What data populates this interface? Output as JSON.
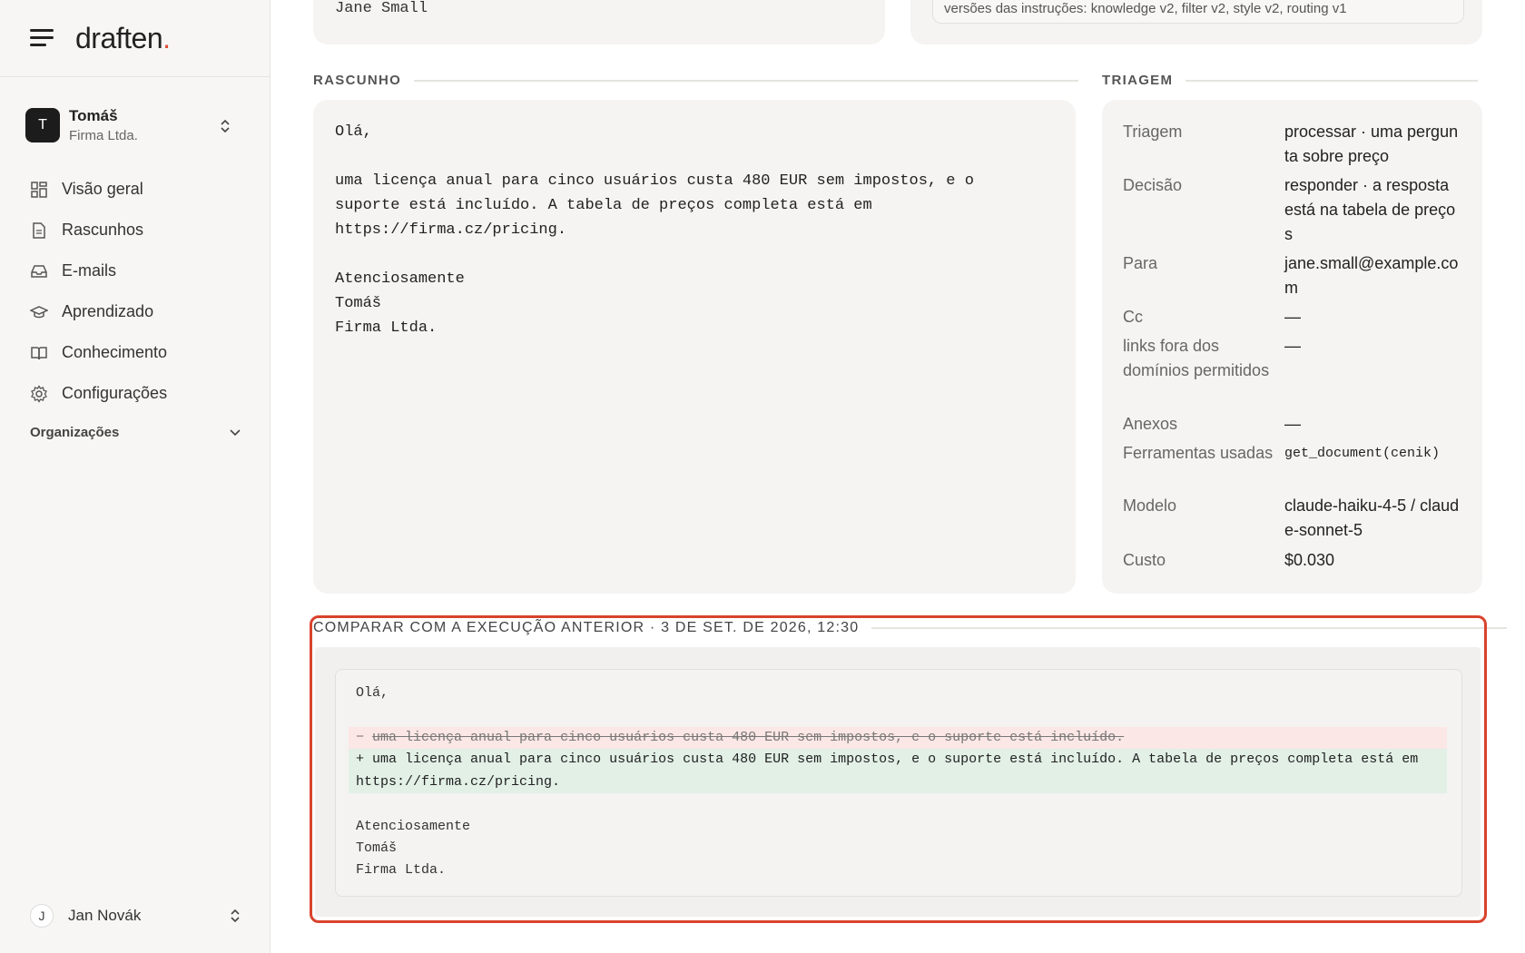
{
  "sidebar": {
    "brand": {
      "name": "draften",
      "dot": "."
    },
    "account": {
      "initial": "T",
      "name": "Tomáš",
      "org": "Firma Ltda."
    },
    "nav": [
      {
        "label": "Visão geral",
        "icon": "grid-icon"
      },
      {
        "label": "Rascunhos",
        "icon": "document-icon"
      },
      {
        "label": "E-mails",
        "icon": "inbox-icon"
      },
      {
        "label": "Aprendizado",
        "icon": "graduation-cap-icon"
      },
      {
        "label": "Conhecimento",
        "icon": "book-icon"
      },
      {
        "label": "Configurações",
        "icon": "gear-icon"
      }
    ],
    "organizations_label": "Organizações",
    "user": {
      "initial": "J",
      "name": "Jan Novák"
    }
  },
  "top": {
    "recipient_name": "Jane Small",
    "instructions_versions": "versões das instruções: knowledge v2, filter v2, style v2, routing v1"
  },
  "draft": {
    "label": "RASCUNHO",
    "lines": [
      "Olá,",
      "",
      "uma licença anual para cinco usuários custa 480 EUR sem impostos, e o",
      "suporte está incluído. A tabela de preços completa está em",
      "https://firma.cz/pricing.",
      "",
      "Atenciosamente",
      "Tomáš",
      "Firma Ltda."
    ]
  },
  "triage": {
    "label": "TRIAGEM",
    "rows": [
      {
        "key": "Triagem",
        "value": "processar · uma pergunta sobre preço"
      },
      {
        "key": "Decisão",
        "value": "responder · a resposta está na tabela de preços"
      },
      {
        "key": "Para",
        "value": "jane.small@example.com"
      },
      {
        "key": "Cc",
        "value": "—"
      },
      {
        "key": "links fora dos domínios permitidos",
        "value": "—"
      },
      {
        "key": "Anexos",
        "value": "—"
      },
      {
        "key": "Ferramentas usadas",
        "value": "get_document(cenik)"
      },
      {
        "key": "Modelo",
        "value": "claude-haiku-4-5 / claude-sonnet-5"
      },
      {
        "key": "Custo",
        "value": "$0.030"
      }
    ]
  },
  "compare": {
    "label": "COMPARAR COM A EXECUÇÃO ANTERIOR · 3 DE SET. DE 2026, 12:30",
    "diff": [
      {
        "type": "context",
        "text": "Olá,"
      },
      {
        "type": "context",
        "text": ""
      },
      {
        "type": "removed",
        "prefix": "−",
        "text": "uma licença anual para cinco usuários custa 480 EUR sem impostos, e o suporte está incluído."
      },
      {
        "type": "added",
        "prefix": "+",
        "text": "uma licença anual para cinco usuários custa 480 EUR sem impostos, e o suporte está incluído. A tabela de preços completa está em https://firma.cz/pricing."
      },
      {
        "type": "context",
        "text": ""
      },
      {
        "type": "context",
        "text": "Atenciosamente"
      },
      {
        "type": "context",
        "text": "Tomáš"
      },
      {
        "type": "context",
        "text": "Firma Ltda."
      }
    ]
  },
  "colors": {
    "accent": "#e14b34",
    "highlight_border": "#d9432d",
    "removed_bg": "#fbe7e5",
    "added_bg": "#e2f0e6"
  }
}
